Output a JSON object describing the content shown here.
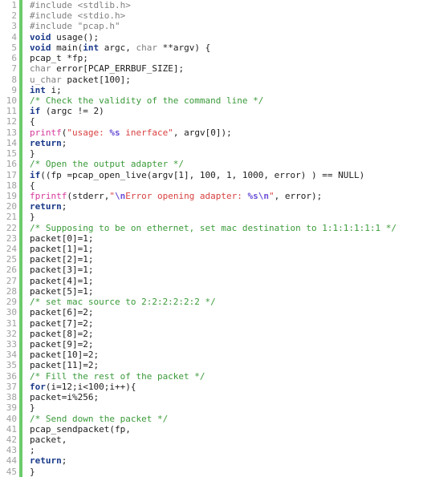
{
  "editor": {
    "name": "code-listing",
    "language": "c",
    "total_lines": 45,
    "colors": {
      "background": "#ffffff",
      "line_number": "#a0a0a0",
      "gutter_bar": "#6ccb6c",
      "text": "#1c1c1c",
      "preprocessor": "#808080",
      "keyword": "#1a3a8a",
      "type": "#808080",
      "function": "#d6389a",
      "string": "#d94040",
      "escape": "#6a4fd6",
      "comment": "#3a9a3a"
    }
  },
  "lines": [
    {
      "number": "1",
      "text": "#include <stdlib.h>",
      "tokens": [
        {
          "t": "#include <stdlib.h>",
          "c": "tok-pre"
        }
      ]
    },
    {
      "number": "2",
      "text": "#include <stdio.h>",
      "tokens": [
        {
          "t": "#include <stdio.h>",
          "c": "tok-pre"
        }
      ]
    },
    {
      "number": "3",
      "text": "#include \"pcap.h\"",
      "tokens": [
        {
          "t": "#include \"pcap.h\"",
          "c": "tok-pre"
        }
      ]
    },
    {
      "number": "4",
      "text": "void usage();",
      "tokens": [
        {
          "t": "void",
          "c": "tok-keyword"
        },
        {
          "t": " usage();",
          "c": "tok-plain"
        }
      ]
    },
    {
      "number": "5",
      "text": "void main(int argc, char **argv) {",
      "tokens": [
        {
          "t": "void",
          "c": "tok-keyword"
        },
        {
          "t": " main(",
          "c": "tok-plain"
        },
        {
          "t": "int",
          "c": "tok-keyword"
        },
        {
          "t": " argc, ",
          "c": "tok-plain"
        },
        {
          "t": "char",
          "c": "tok-type"
        },
        {
          "t": " **argv) {",
          "c": "tok-plain"
        }
      ]
    },
    {
      "number": "6",
      "text": "pcap_t *fp;",
      "tokens": [
        {
          "t": "pcap_t *fp;",
          "c": "tok-plain"
        }
      ]
    },
    {
      "number": "7",
      "text": "char error[PCAP_ERRBUF_SIZE];",
      "tokens": [
        {
          "t": "char",
          "c": "tok-type"
        },
        {
          "t": " error[PCAP_ERRBUF_SIZE];",
          "c": "tok-plain"
        }
      ]
    },
    {
      "number": "8",
      "text": "u_char packet[100];",
      "tokens": [
        {
          "t": "u_char",
          "c": "tok-type"
        },
        {
          "t": " packet[100];",
          "c": "tok-plain"
        }
      ]
    },
    {
      "number": "9",
      "text": "int i;",
      "tokens": [
        {
          "t": "int",
          "c": "tok-keyword"
        },
        {
          "t": " i;",
          "c": "tok-plain"
        }
      ]
    },
    {
      "number": "10",
      "text": "/* Check the validity of the command line */",
      "tokens": [
        {
          "t": "/* Check the validity of the command line */",
          "c": "tok-comment"
        }
      ]
    },
    {
      "number": "11",
      "text": "if (argc != 2)",
      "tokens": [
        {
          "t": "if",
          "c": "tok-keyword"
        },
        {
          "t": " (argc != 2)",
          "c": "tok-plain"
        }
      ]
    },
    {
      "number": "12",
      "text": "{",
      "tokens": [
        {
          "t": "{",
          "c": "tok-plain"
        }
      ]
    },
    {
      "number": "13",
      "text": "printf(\"usage: %s inerface\", argv[0]);",
      "tokens": [
        {
          "t": "printf",
          "c": "tok-func"
        },
        {
          "t": "(",
          "c": "tok-plain"
        },
        {
          "t": "\"usage: ",
          "c": "tok-string"
        },
        {
          "t": "%s",
          "c": "tok-esc"
        },
        {
          "t": " inerface\"",
          "c": "tok-string"
        },
        {
          "t": ", argv[0]);",
          "c": "tok-plain"
        }
      ]
    },
    {
      "number": "14",
      "text": "return;",
      "tokens": [
        {
          "t": "return",
          "c": "tok-keyword"
        },
        {
          "t": ";",
          "c": "tok-plain"
        }
      ]
    },
    {
      "number": "15",
      "text": "}",
      "tokens": [
        {
          "t": "}",
          "c": "tok-plain"
        }
      ]
    },
    {
      "number": "16",
      "text": "/* Open the output adapter */",
      "tokens": [
        {
          "t": "/* Open the output adapter */",
          "c": "tok-comment"
        }
      ]
    },
    {
      "number": "17",
      "text": "if((fp =pcap_open_live(argv[1], 100, 1, 1000, error) ) == NULL)",
      "tokens": [
        {
          "t": "if",
          "c": "tok-keyword"
        },
        {
          "t": "((fp =pcap_open_live(argv[1], 100, 1, 1000, error) ) == NULL)",
          "c": "tok-plain"
        }
      ]
    },
    {
      "number": "18",
      "text": "{",
      "tokens": [
        {
          "t": "{",
          "c": "tok-plain"
        }
      ]
    },
    {
      "number": "19",
      "text": "fprintf(stderr,\"\\nError opening adapter: %s\\n\", error);",
      "tokens": [
        {
          "t": "fprintf",
          "c": "tok-func"
        },
        {
          "t": "(stderr,",
          "c": "tok-plain"
        },
        {
          "t": "\"",
          "c": "tok-string"
        },
        {
          "t": "\\n",
          "c": "tok-esc"
        },
        {
          "t": "Error opening adapter: ",
          "c": "tok-string"
        },
        {
          "t": "%s",
          "c": "tok-esc"
        },
        {
          "t": "\\n",
          "c": "tok-esc"
        },
        {
          "t": "\"",
          "c": "tok-string"
        },
        {
          "t": ", error);",
          "c": "tok-plain"
        }
      ]
    },
    {
      "number": "20",
      "text": "return;",
      "tokens": [
        {
          "t": "return",
          "c": "tok-keyword"
        },
        {
          "t": ";",
          "c": "tok-plain"
        }
      ]
    },
    {
      "number": "21",
      "text": "}",
      "tokens": [
        {
          "t": "}",
          "c": "tok-plain"
        }
      ]
    },
    {
      "number": "22",
      "text": "/* Supposing to be on ethernet, set mac destination to 1:1:1:1:1:1 */",
      "tokens": [
        {
          "t": "/* Supposing to be on ethernet, set mac destination to 1:1:1:1:1:1 */",
          "c": "tok-comment"
        }
      ]
    },
    {
      "number": "23",
      "text": "packet[0]=1;",
      "tokens": [
        {
          "t": "packet[0]=1;",
          "c": "tok-plain"
        }
      ]
    },
    {
      "number": "24",
      "text": "packet[1]=1;",
      "tokens": [
        {
          "t": "packet[1]=1;",
          "c": "tok-plain"
        }
      ]
    },
    {
      "number": "25",
      "text": "packet[2]=1;",
      "tokens": [
        {
          "t": "packet[2]=1;",
          "c": "tok-plain"
        }
      ]
    },
    {
      "number": "26",
      "text": "packet[3]=1;",
      "tokens": [
        {
          "t": "packet[3]=1;",
          "c": "tok-plain"
        }
      ]
    },
    {
      "number": "27",
      "text": "packet[4]=1;",
      "tokens": [
        {
          "t": "packet[4]=1;",
          "c": "tok-plain"
        }
      ]
    },
    {
      "number": "28",
      "text": "packet[5]=1;",
      "tokens": [
        {
          "t": "packet[5]=1;",
          "c": "tok-plain"
        }
      ]
    },
    {
      "number": "29",
      "text": "/* set mac source to 2:2:2:2:2:2 */",
      "tokens": [
        {
          "t": "/* set mac source to 2:2:2:2:2:2 */",
          "c": "tok-comment"
        }
      ]
    },
    {
      "number": "30",
      "text": "packet[6]=2;",
      "tokens": [
        {
          "t": "packet[6]=2;",
          "c": "tok-plain"
        }
      ]
    },
    {
      "number": "31",
      "text": "packet[7]=2;",
      "tokens": [
        {
          "t": "packet[7]=2;",
          "c": "tok-plain"
        }
      ]
    },
    {
      "number": "32",
      "text": "packet[8]=2;",
      "tokens": [
        {
          "t": "packet[8]=2;",
          "c": "tok-plain"
        }
      ]
    },
    {
      "number": "33",
      "text": "packet[9]=2;",
      "tokens": [
        {
          "t": "packet[9]=2;",
          "c": "tok-plain"
        }
      ]
    },
    {
      "number": "34",
      "text": "packet[10]=2;",
      "tokens": [
        {
          "t": "packet[10]=2;",
          "c": "tok-plain"
        }
      ]
    },
    {
      "number": "35",
      "text": "packet[11]=2;",
      "tokens": [
        {
          "t": "packet[11]=2;",
          "c": "tok-plain"
        }
      ]
    },
    {
      "number": "36",
      "text": "/* Fill the rest of the packet */",
      "tokens": [
        {
          "t": "/* Fill the rest of the packet */",
          "c": "tok-comment"
        }
      ]
    },
    {
      "number": "37",
      "text": "for(i=12;i<100;i++){",
      "tokens": [
        {
          "t": "for",
          "c": "tok-keyword"
        },
        {
          "t": "(i=12;i<100;i++){",
          "c": "tok-plain"
        }
      ]
    },
    {
      "number": "38",
      "text": "packet=i%256;",
      "tokens": [
        {
          "t": "packet=i%256;",
          "c": "tok-plain"
        }
      ]
    },
    {
      "number": "39",
      "text": "}",
      "tokens": [
        {
          "t": "}",
          "c": "tok-plain"
        }
      ]
    },
    {
      "number": "40",
      "text": "/* Send down the packet */",
      "tokens": [
        {
          "t": "/* Send down the packet */",
          "c": "tok-comment"
        }
      ]
    },
    {
      "number": "41",
      "text": "pcap_sendpacket(fp,",
      "tokens": [
        {
          "t": "pcap_sendpacket(fp,",
          "c": "tok-plain"
        }
      ]
    },
    {
      "number": "42",
      "text": "packet,",
      "tokens": [
        {
          "t": "packet,",
          "c": "tok-plain"
        }
      ]
    },
    {
      "number": "43",
      "text": ";",
      "tokens": [
        {
          "t": ";",
          "c": "tok-plain"
        }
      ]
    },
    {
      "number": "44",
      "text": "return;",
      "tokens": [
        {
          "t": "return",
          "c": "tok-keyword"
        },
        {
          "t": ";",
          "c": "tok-plain"
        }
      ]
    },
    {
      "number": "45",
      "text": "}",
      "tokens": [
        {
          "t": "}",
          "c": "tok-plain"
        }
      ]
    }
  ]
}
